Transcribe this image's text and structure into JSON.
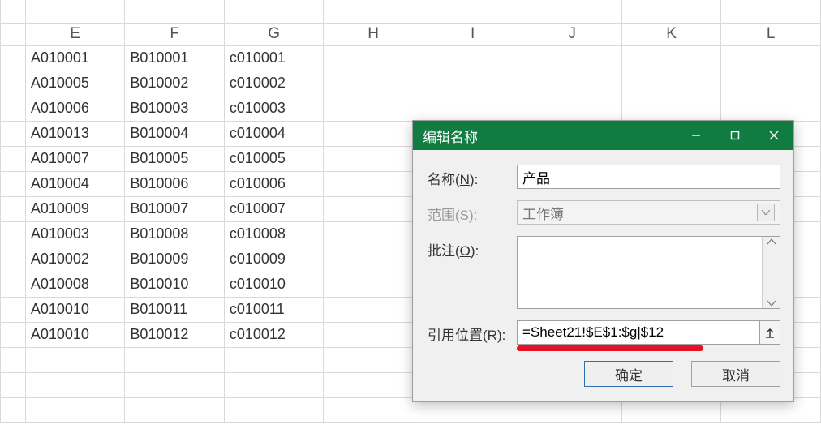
{
  "columns": [
    "E",
    "F",
    "G",
    "H",
    "I",
    "J",
    "K",
    "L"
  ],
  "rows": [
    {
      "E": "A010001",
      "F": "B010001",
      "G": "c010001"
    },
    {
      "E": "A010005",
      "F": "B010002",
      "G": "c010002"
    },
    {
      "E": "A010006",
      "F": "B010003",
      "G": "c010003"
    },
    {
      "E": "A010013",
      "F": "B010004",
      "G": "c010004"
    },
    {
      "E": "A010007",
      "F": "B010005",
      "G": "c010005"
    },
    {
      "E": "A010004",
      "F": "B010006",
      "G": "c010006"
    },
    {
      "E": "A010009",
      "F": "B010007",
      "G": "c010007"
    },
    {
      "E": "A010003",
      "F": "B010008",
      "G": "c010008"
    },
    {
      "E": "A010002",
      "F": "B010009",
      "G": "c010009"
    },
    {
      "E": "A010008",
      "F": "B010010",
      "G": "c010010"
    },
    {
      "E": "A010010",
      "F": "B010011",
      "G": "c010011"
    },
    {
      "E": "A010010",
      "F": "B010012",
      "G": "c010012"
    }
  ],
  "dialog": {
    "title": "编辑名称",
    "labels": {
      "name_prefix": "名称(",
      "name_key": "N",
      "name_suffix": "):",
      "scope": "范围(S):",
      "comment_prefix": "批注(",
      "comment_key": "O",
      "comment_suffix": "):",
      "ref_prefix": "引用位置(",
      "ref_key": "R",
      "ref_suffix": "):"
    },
    "name_value": "产品",
    "scope_value": "工作簿",
    "comment_value": "",
    "ref_value": "=Sheet21!$E$1:$g|$12",
    "ok": "确定",
    "cancel": "取消"
  }
}
